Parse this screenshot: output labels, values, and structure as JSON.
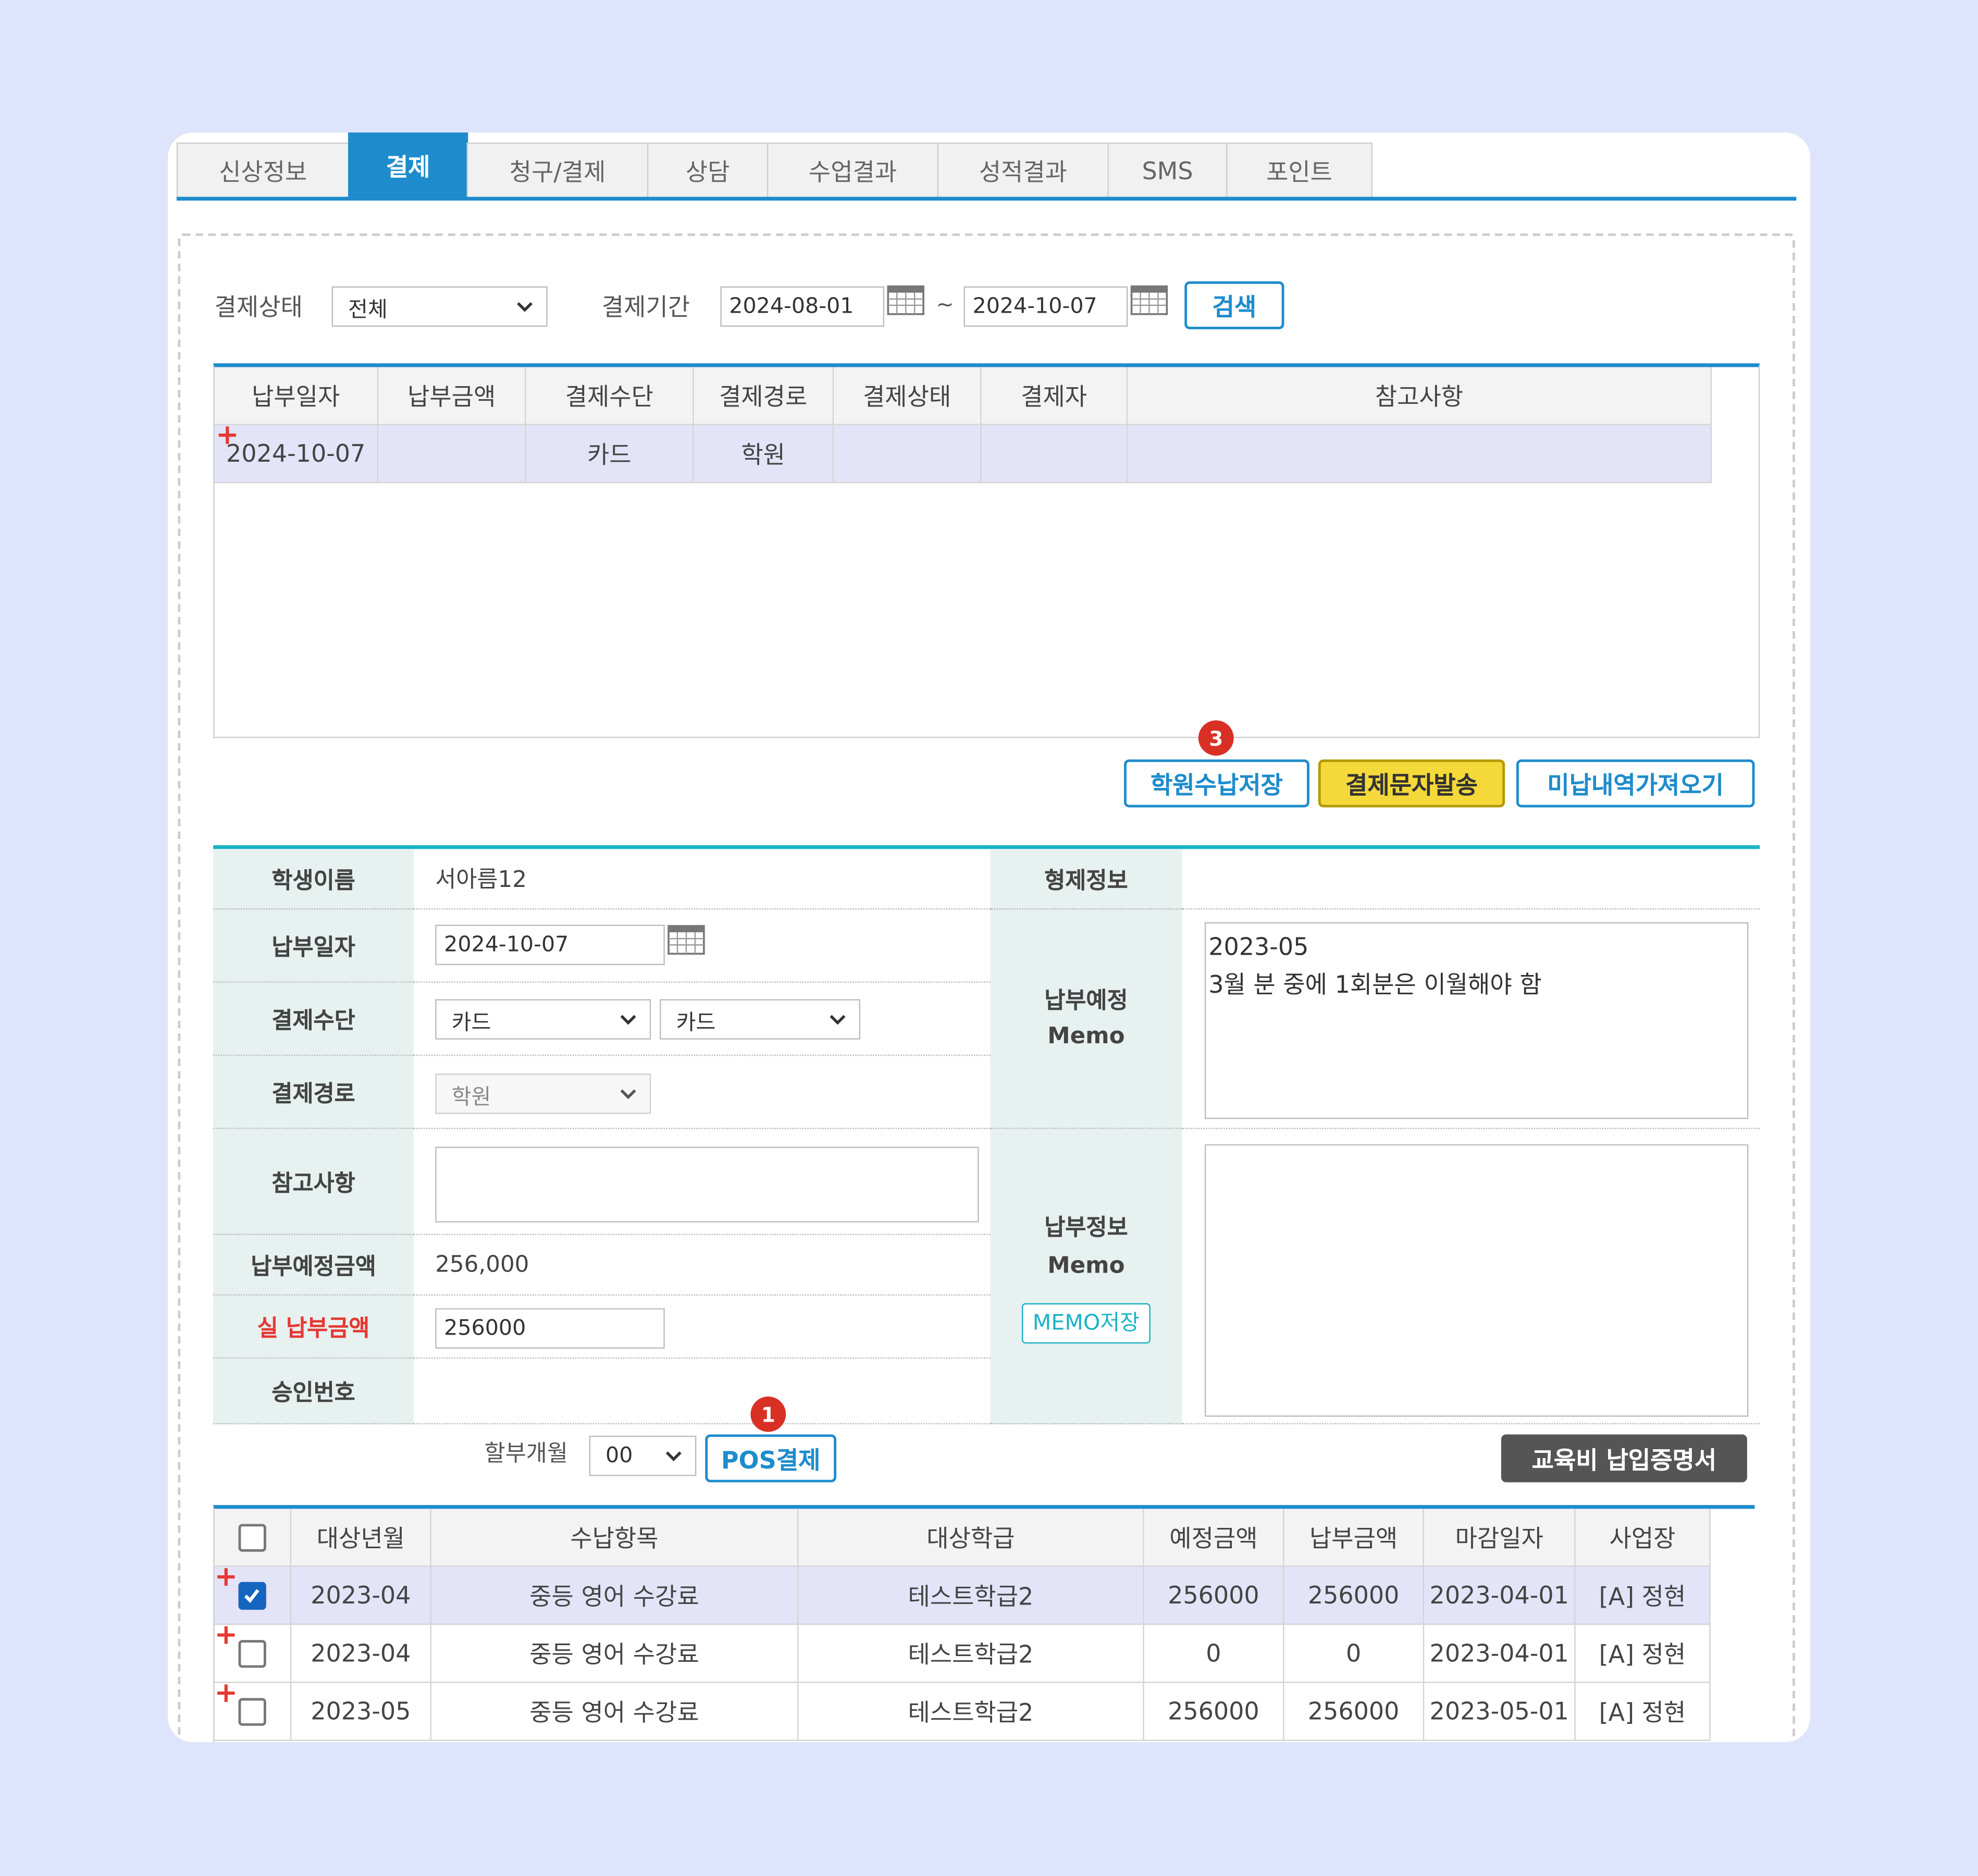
{
  "tabs": [
    "신상정보",
    "결제",
    "청구/결제",
    "상담",
    "수업결과",
    "성적결과",
    "SMS",
    "포인트"
  ],
  "active_tab": "결제",
  "search": {
    "status_label": "결제상태",
    "status_value": "전체",
    "period_label": "결제기간",
    "date_from": "2024-08-01",
    "tilde": "~",
    "date_to": "2024-10-07",
    "search_button": "검색"
  },
  "payment_table": {
    "headers": [
      "납부일자",
      "납부금액",
      "결제수단",
      "결제경로",
      "결제상태",
      "결제자",
      "참고사항"
    ],
    "rows": [
      [
        "2024-10-07",
        "",
        "카드",
        "학원",
        "",
        "",
        ""
      ]
    ]
  },
  "actions": {
    "save_academy": "학원수납저장",
    "send_sms": "결제문자발송",
    "load_unpaid": "미납내역가져오기",
    "badge_3": "3"
  },
  "form": {
    "student_name_label": "학생이름",
    "student_name": "서아름12",
    "sibling_label": "형제정보",
    "pay_date_label": "납부일자",
    "pay_date": "2024-10-07",
    "method_label": "결제수단",
    "method_1": "카드",
    "method_2": "카드",
    "route_label": "결제경로",
    "route": "학원",
    "note_label": "참고사항",
    "expected_amount_label": "납부예정금액",
    "expected_amount": "256,000",
    "actual_amount_label": "실 납부금액",
    "actual_amount": "256000",
    "approval_label": "승인번호",
    "plan_memo_label_1": "납부예정",
    "plan_memo_label_2": "Memo",
    "plan_memo_line_1": "2023-05",
    "plan_memo_line_2": "3월 분 중에 1회분은 이월해야 함",
    "info_memo_label_1": "납부정보",
    "info_memo_label_2": "Memo",
    "memo_save": "MEMO저장"
  },
  "pos": {
    "installment_label": "할부개월",
    "installment_value": "00",
    "pos_button": "POS결제",
    "badge_1": "1",
    "certificate_button": "교육비 납입증명서"
  },
  "items_table": {
    "headers": [
      "대상년월",
      "수납항목",
      "대상학급",
      "예정금액",
      "납부금액",
      "마감일자",
      "사업장"
    ],
    "rows": [
      {
        "checked": true,
        "cells": [
          "2023-04",
          "중등 영어 수강료",
          "테스트학급2",
          "256000",
          "256000",
          "2023-04-01",
          "[A] 정현"
        ]
      },
      {
        "checked": false,
        "cells": [
          "2023-04",
          "중등 영어 수강료",
          "테스트학급2",
          "0",
          "0",
          "2023-04-01",
          "[A] 정현"
        ]
      },
      {
        "checked": false,
        "cells": [
          "2023-05",
          "중등 영어 수강료",
          "테스트학급2",
          "256000",
          "256000",
          "2023-05-01",
          "[A] 정현"
        ]
      }
    ]
  },
  "colors": {
    "accent": "#1e8ccc",
    "teal": "#1ab3c4",
    "warning_label": "#e53935",
    "selected_row": "#e3e4f8"
  }
}
